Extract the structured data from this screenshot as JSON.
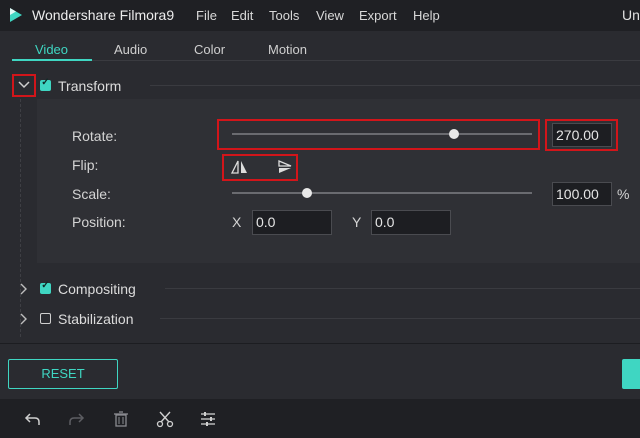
{
  "app": {
    "title": "Wondershare Filmora9",
    "title_right_truncated": "Un"
  },
  "menu": [
    "File",
    "Edit",
    "Tools",
    "View",
    "Export",
    "Help"
  ],
  "tabs": [
    {
      "label": "Video",
      "active": true
    },
    {
      "label": "Audio",
      "active": false
    },
    {
      "label": "Color",
      "active": false
    },
    {
      "label": "Motion",
      "active": false
    }
  ],
  "sections": {
    "transform": {
      "label": "Transform",
      "checked": true,
      "expanded": true
    },
    "compositing": {
      "label": "Compositing",
      "checked": true,
      "expanded": false
    },
    "stabilization": {
      "label": "Stabilization",
      "checked": false,
      "expanded": false
    }
  },
  "transform": {
    "rotate": {
      "label": "Rotate:",
      "value": "270.00",
      "slider_fraction": 0.74
    },
    "flip": {
      "label": "Flip:"
    },
    "scale": {
      "label": "Scale:",
      "value": "100.00",
      "unit": "%",
      "slider_fraction": 0.25
    },
    "position": {
      "label": "Position:",
      "x_label": "X",
      "x_value": "0.0",
      "y_label": "Y",
      "y_value": "0.0"
    }
  },
  "buttons": {
    "reset": "RESET"
  },
  "icons": {
    "logo": "filmora-logo-icon",
    "undo": "undo-icon",
    "redo": "redo-icon",
    "delete": "trash-icon",
    "cut": "scissors-icon",
    "adjust": "sliders-icon"
  },
  "colors": {
    "accent": "#3fd6c2",
    "highlight": "#d2151a",
    "background": "#2a2b30"
  }
}
